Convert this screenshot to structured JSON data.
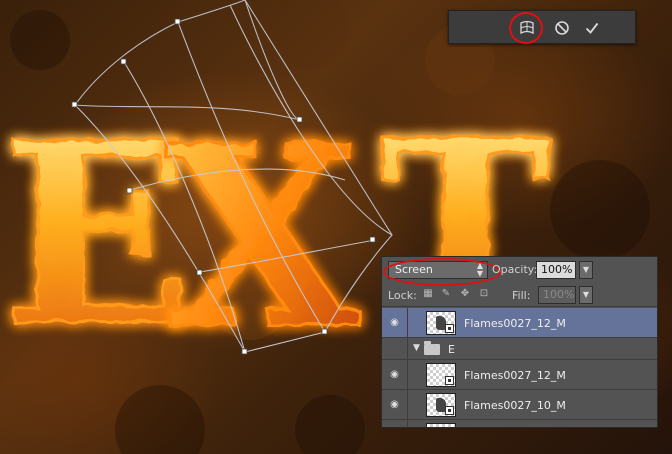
{
  "canvas": {
    "letters": [
      "E",
      "X",
      "T"
    ],
    "colors": {
      "flame_core": "#fff3a0",
      "flame_mid": "#ffb020",
      "flame_edge": "#e25a08",
      "background": "#3a200a"
    }
  },
  "transform_bar": {
    "warp_icon": "warp-mode-icon",
    "cancel_icon": "cancel-icon",
    "commit_icon": "checkmark-icon",
    "highlight_color": "#e01010"
  },
  "layers_panel": {
    "blend_mode": "Screen",
    "opacity_label": "Opacity:",
    "opacity_value": "100%",
    "lock_label": "Lock:",
    "fill_label": "Fill:",
    "fill_value": "100%",
    "selected_color": "#65739a",
    "layers": [
      {
        "name": "Flames0027_12_M",
        "selected": true
      },
      {
        "group": true,
        "name": "E",
        "expanded": true
      },
      {
        "name": "Flames0027_12_M",
        "selected": false
      },
      {
        "name": "Flames0027_10_M",
        "selected": false
      },
      {
        "name": "",
        "selected": false
      }
    ]
  }
}
